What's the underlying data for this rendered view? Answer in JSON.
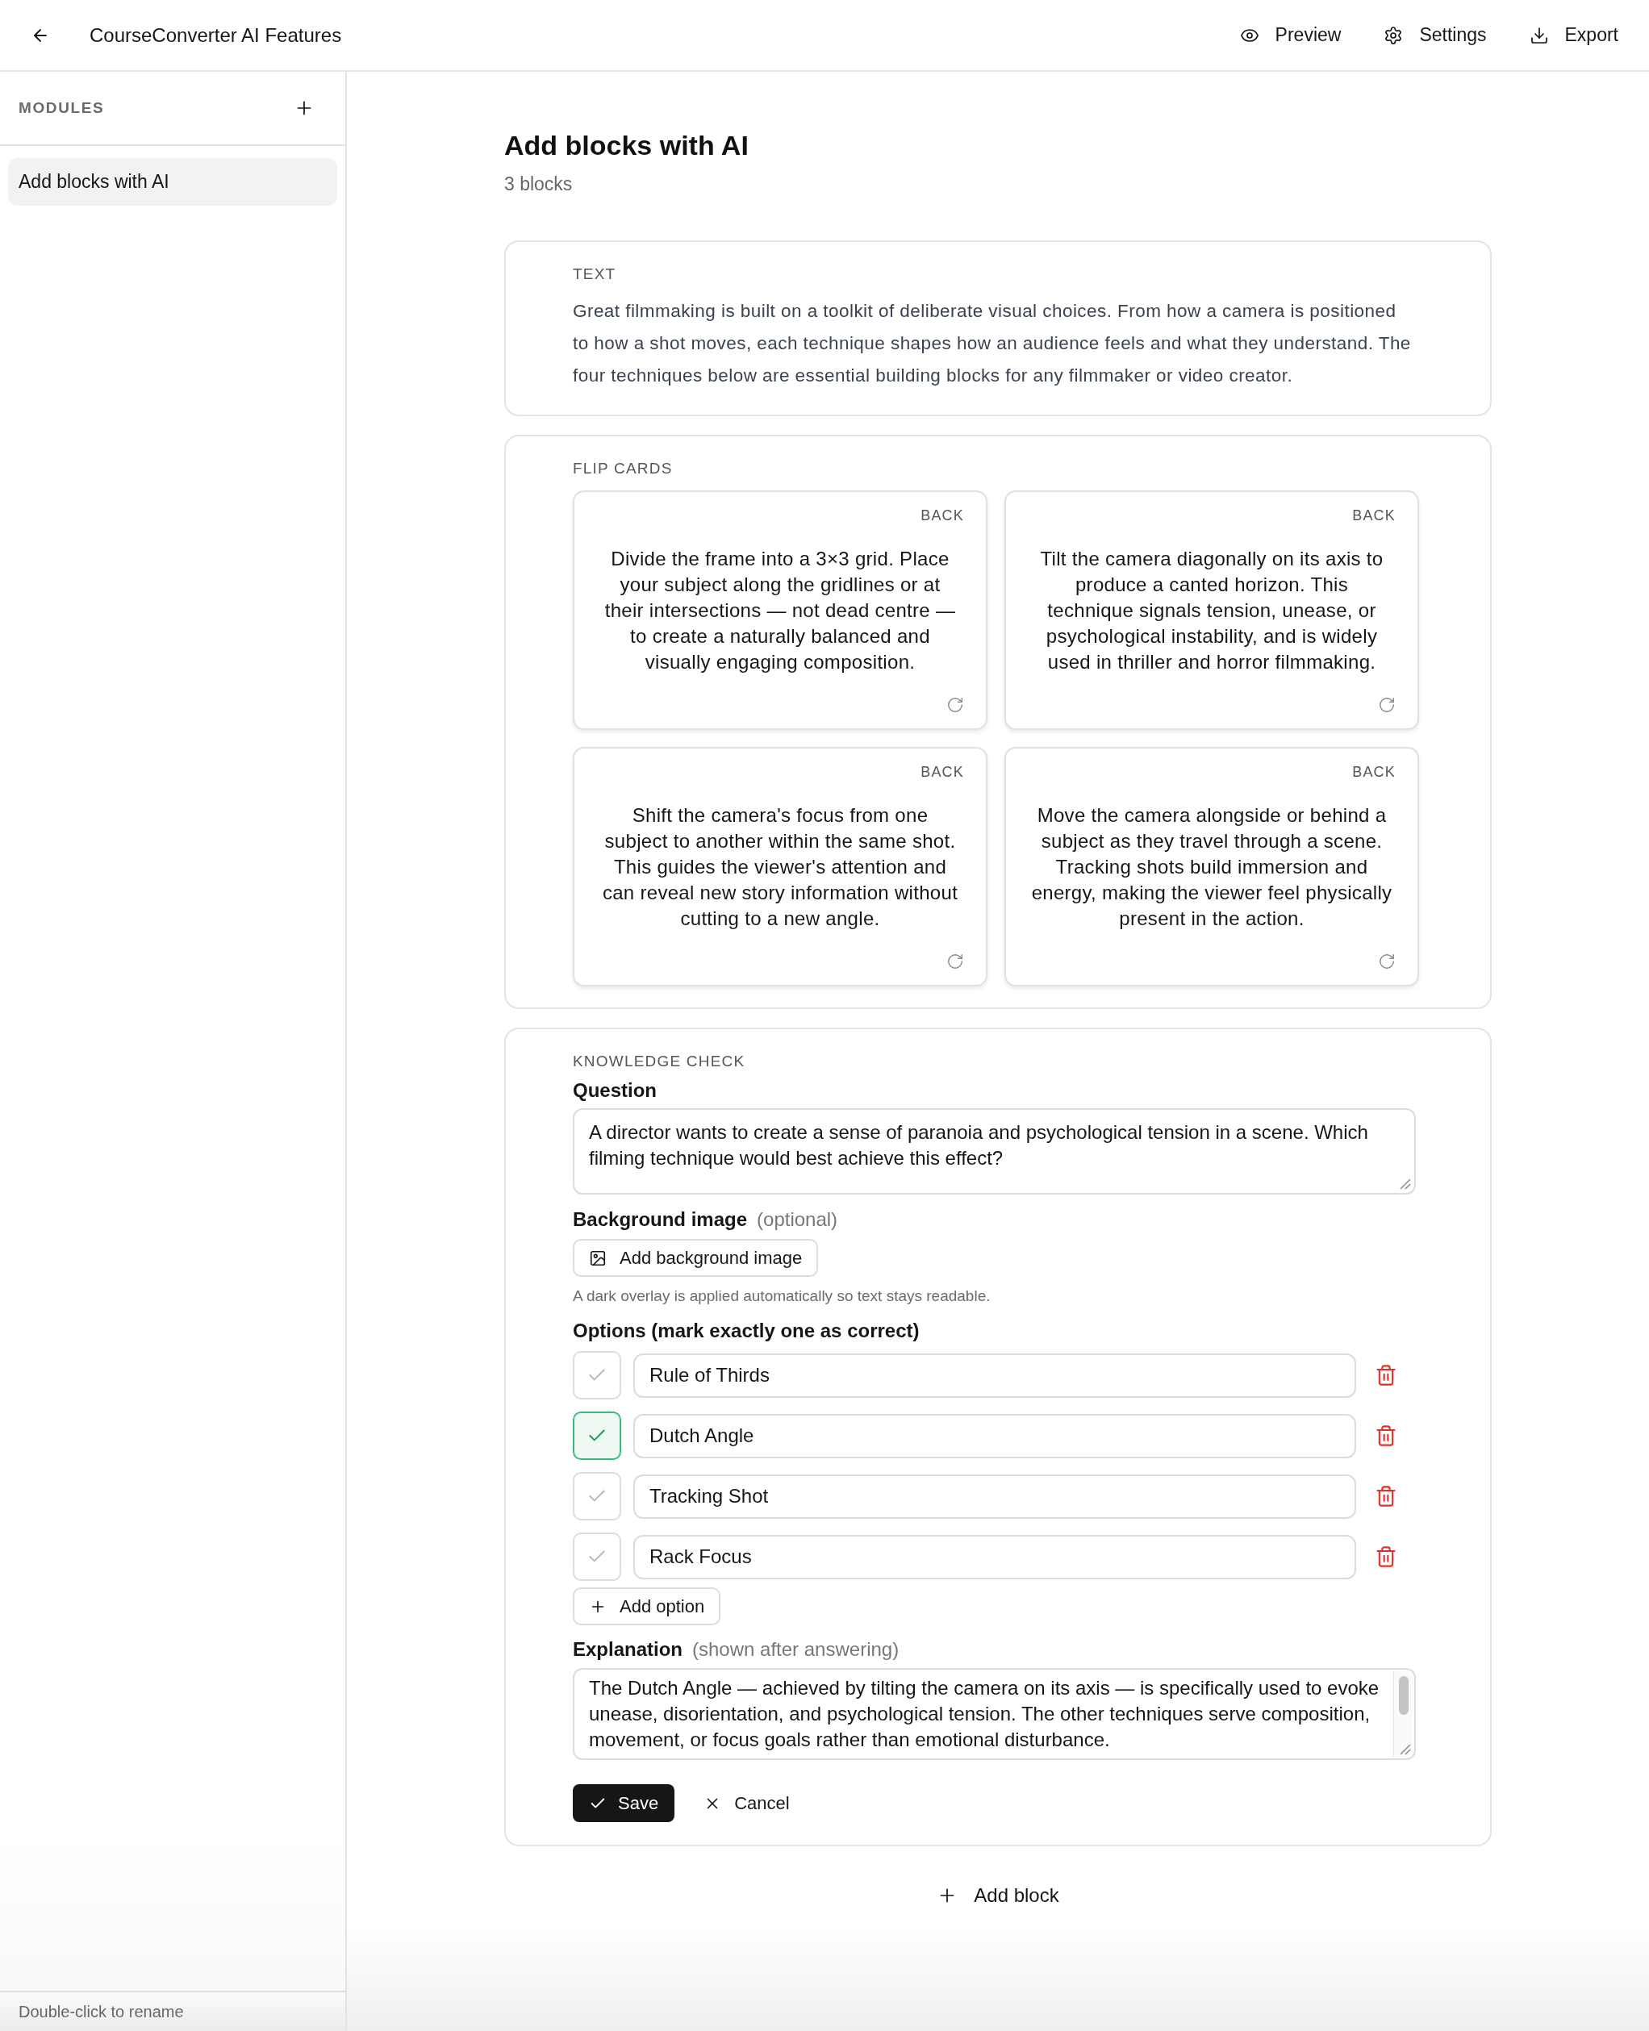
{
  "header": {
    "title": "CourseConverter AI Features",
    "actions": [
      {
        "label": "Preview"
      },
      {
        "label": "Settings"
      },
      {
        "label": "Export"
      }
    ]
  },
  "sidebar": {
    "heading": "MODULES",
    "items": [
      {
        "label": "Add blocks with AI",
        "selected": true
      }
    ],
    "footer": "Double-click to rename"
  },
  "page": {
    "title": "Add blocks with AI",
    "subtitle": "3 blocks"
  },
  "blocks": [
    {
      "kind": "text",
      "label": "TEXT",
      "body": "Great filmmaking is built on a toolkit of deliberate visual choices. From how a camera is positioned to how a shot moves, each technique shapes how an audience feels and what they understand. The four techniques below are essential building blocks for any filmmaker or video creator."
    },
    {
      "kind": "flip_cards",
      "label": "FLIP CARDS",
      "cards": [
        {
          "side": "BACK",
          "text": "Divide the frame into a 3×3 grid. Place your subject along the gridlines or at their intersections — not dead centre — to create a naturally balanced and visually engaging composition."
        },
        {
          "side": "BACK",
          "text": "Tilt the camera diagonally on its axis to produce a canted horizon. This technique signals tension, unease, or psychological instability, and is widely used in thriller and horror filmmaking."
        },
        {
          "side": "BACK",
          "text": "Shift the camera's focus from one subject to another within the same shot. This guides the viewer's attention and can reveal new story information without cutting to a new angle."
        },
        {
          "side": "BACK",
          "text": "Move the camera alongside or behind a subject as they travel through a scene. Tracking shots build immersion and energy, making the viewer feel physically present in the action."
        }
      ]
    },
    {
      "kind": "knowledge_check",
      "label": "KNOWLEDGE CHECK",
      "question_label": "Question",
      "question": "A director wants to create a sense of paranoia and psychological tension in a scene. Which filming technique would best achieve this effect?",
      "background_label": "Background image",
      "background_note": "(optional)",
      "background_button": "Add background image",
      "background_hint": "A dark overlay is applied automatically so text stays readable.",
      "options_label": "Options (mark exactly one as correct)",
      "options": [
        {
          "text": "Rule of Thirds",
          "checked": false
        },
        {
          "text": "Dutch Angle",
          "checked": true
        },
        {
          "text": "Tracking Shot",
          "checked": false
        },
        {
          "text": "Rack Focus",
          "checked": false
        }
      ],
      "add_option": "Add option",
      "explanation_label": "Explanation",
      "explanation_note": "(shown after answering)",
      "explanation": "The Dutch Angle — achieved by tilting the camera on its axis — is specifically used to evoke unease, disorientation, and psychological tension. The other techniques serve composition, movement, or focus goals rather than emotional disturbance.",
      "save": "Save",
      "cancel": "Cancel"
    }
  ],
  "add_block": "Add block"
}
